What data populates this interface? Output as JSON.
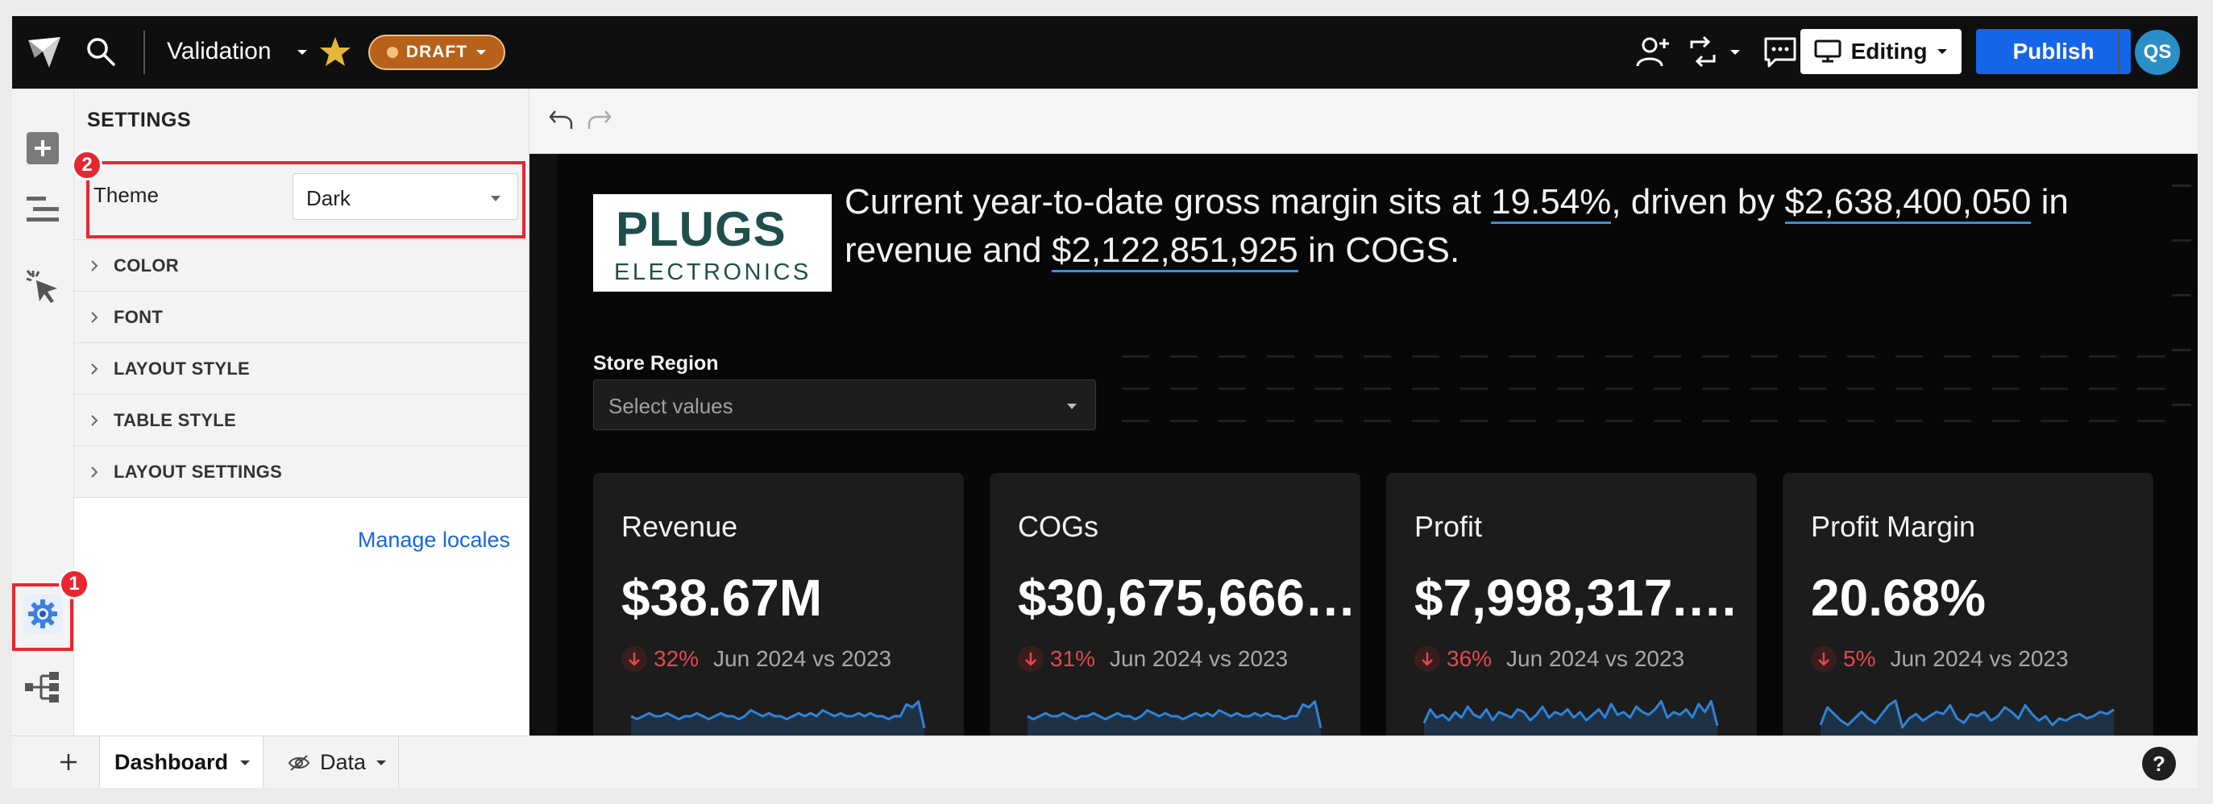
{
  "topbar": {
    "title": "Validation",
    "status_badge": "DRAFT",
    "mode_label": "Editing",
    "publish_label": "Publish",
    "avatar_initials": "QS"
  },
  "settings": {
    "header": "SETTINGS",
    "theme_label": "Theme",
    "theme_value": "Dark",
    "sections": [
      "COLOR",
      "FONT",
      "LAYOUT STYLE",
      "TABLE STYLE",
      "LAYOUT SETTINGS"
    ],
    "manage_locales": "Manage locales"
  },
  "canvas": {
    "logo_text_top": "PLUGS",
    "logo_text_bottom": "ELECTRONICS",
    "headline": {
      "part1": "Current year-to-date gross margin sits at ",
      "margin": "19.54%",
      "part2": ", driven by ",
      "revenue": "$2,638,400,050",
      "part3": " in revenue and ",
      "cogs": "$2,122,851,925",
      "part4": " in COGS."
    },
    "filter": {
      "label": "Store Region",
      "placeholder": "Select values"
    },
    "kpis": [
      {
        "title": "Revenue",
        "value": "$38.67M",
        "delta": "32%",
        "compare": "Jun 2024 vs 2023",
        "trend": [
          6,
          5,
          6,
          7,
          6,
          6,
          7,
          6,
          5,
          6,
          6,
          7,
          6,
          5,
          6,
          7,
          6,
          6,
          5,
          6,
          8,
          7,
          6,
          7,
          6,
          6,
          5,
          6,
          7,
          6,
          7,
          6,
          8,
          7,
          6,
          7,
          6,
          6,
          7,
          6,
          7,
          6,
          6,
          5,
          6,
          6,
          10,
          9,
          11,
          2
        ]
      },
      {
        "title": "COGs",
        "value": "$30,675,666…",
        "delta": "31%",
        "compare": "Jun 2024 vs 2023",
        "trend": [
          6,
          5,
          6,
          7,
          6,
          6,
          7,
          6,
          5,
          6,
          6,
          7,
          6,
          5,
          6,
          7,
          6,
          6,
          5,
          6,
          8,
          7,
          6,
          7,
          6,
          6,
          5,
          6,
          7,
          6,
          7,
          6,
          8,
          7,
          6,
          7,
          6,
          6,
          7,
          6,
          7,
          6,
          6,
          5,
          6,
          6,
          10,
          9,
          11,
          2
        ]
      },
      {
        "title": "Profit",
        "value": "$7,998,317.…",
        "delta": "36%",
        "compare": "Jun 2024 vs 2023",
        "trend": [
          4,
          9,
          6,
          7,
          5,
          8,
          6,
          10,
          7,
          6,
          9,
          5,
          8,
          7,
          6,
          9,
          8,
          5,
          7,
          10,
          6,
          8,
          7,
          9,
          6,
          8,
          5,
          7,
          9,
          6,
          11,
          7,
          8,
          6,
          10,
          8,
          7,
          9,
          12,
          6,
          8,
          7,
          9,
          6,
          11,
          8,
          12,
          3
        ]
      },
      {
        "title": "Profit Margin",
        "value": "20.68%",
        "delta": "5%",
        "compare": "Jun 2024 vs 2023",
        "trend": [
          4,
          12,
          9,
          6,
          4,
          7,
          10,
          7,
          5,
          9,
          13,
          15,
          3,
          7,
          9,
          6,
          8,
          10,
          9,
          13,
          7,
          5,
          9,
          8,
          10,
          6,
          8,
          12,
          10,
          7,
          13,
          9,
          6,
          8,
          4,
          7,
          6,
          8,
          9,
          7,
          8,
          10,
          9,
          11
        ]
      }
    ]
  },
  "tabs": {
    "dashboard": "Dashboard",
    "data": "Data"
  },
  "help_label": "?",
  "callouts": [
    "1",
    "2"
  ],
  "colors": {
    "accent_blue": "#1565e8",
    "badge_orange": "#b8611a",
    "negative_red": "#e5484d",
    "callout_red": "#e8262f",
    "spark_blue": "#2f83d9"
  }
}
